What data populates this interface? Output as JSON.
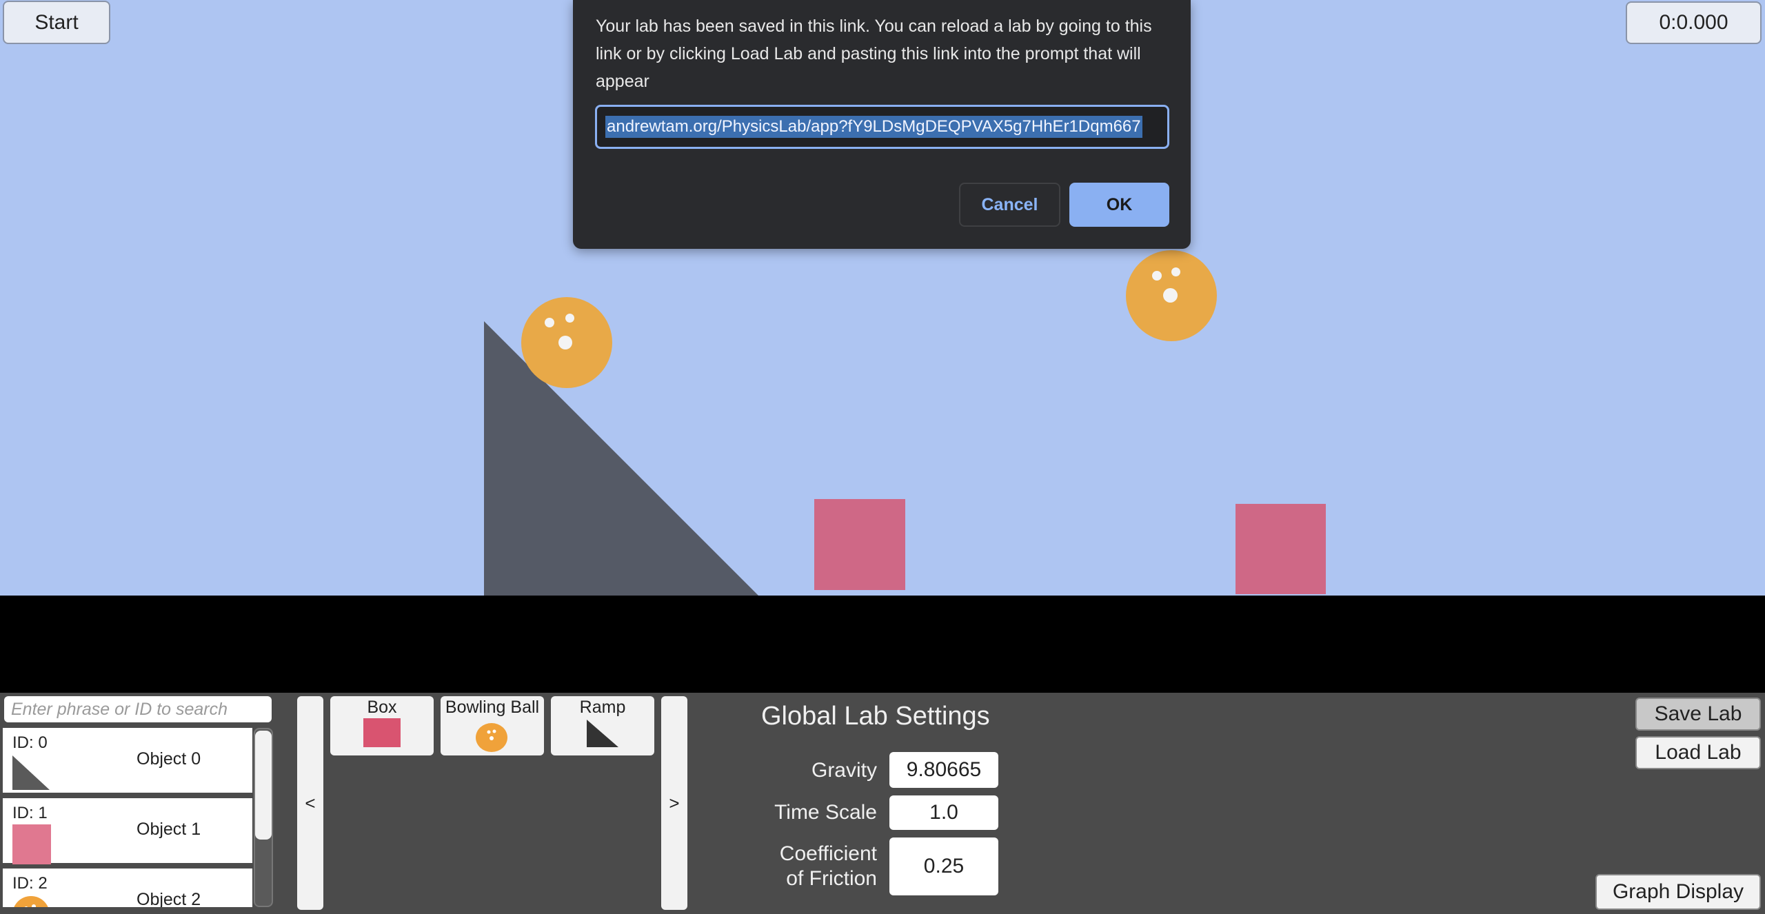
{
  "toolbar": {
    "start_label": "Start",
    "timer": "0:0.000"
  },
  "dialog": {
    "message": "Your lab has been saved in this link. You can reload a lab by going to this link or by clicking Load Lab and pasting this link into the prompt that will appear",
    "link_value": "andrewtam.org/PhysicsLab/app?fY9LDsMgDEQPVAX5g7HhEr1Dqm667",
    "cancel_label": "Cancel",
    "ok_label": "OK"
  },
  "search": {
    "placeholder": "Enter phrase or ID to search"
  },
  "objects": [
    {
      "id": "ID: 0",
      "name": "Object 0",
      "icon": "ramp-icon"
    },
    {
      "id": "ID: 1",
      "name": "Object 1",
      "icon": "box-icon"
    },
    {
      "id": "ID: 2",
      "name": "Object 2",
      "icon": "bowling-ball-icon"
    }
  ],
  "palette": {
    "prev_label": "<",
    "next_label": ">",
    "items": [
      {
        "label": "Box",
        "icon": "box-icon"
      },
      {
        "label": "Bowling Ball",
        "icon": "bowling-ball-icon"
      },
      {
        "label": "Ramp",
        "icon": "ramp-icon"
      }
    ]
  },
  "settings": {
    "title": "Global Lab Settings",
    "gravity_label": "Gravity",
    "gravity_value": "9.80665",
    "time_scale_label": "Time Scale",
    "time_scale_value": "1.0",
    "friction_label_line1": "Coefficient",
    "friction_label_line2": "of Friction",
    "friction_value": "0.25"
  },
  "actions": {
    "save_label": "Save Lab",
    "load_label": "Load Lab",
    "graph_label": "Graph Display"
  },
  "colors": {
    "sky": "#aec5f2",
    "ground": "#000000",
    "panel": "#4b4b4b",
    "ball": "#e8a948",
    "box": "#cf6886",
    "ramp": "#555a66",
    "dialog_accent": "#8ab0f2"
  }
}
